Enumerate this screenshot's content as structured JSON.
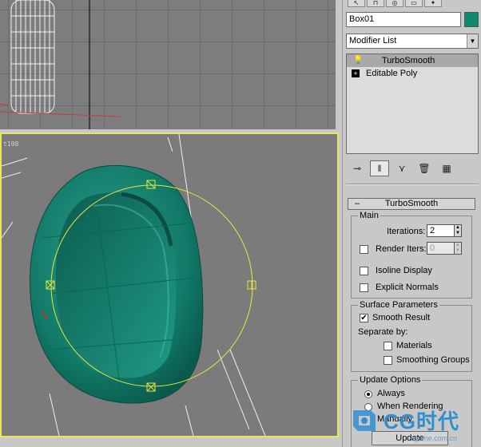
{
  "viewport": {
    "persp_label": "t198"
  },
  "panel": {
    "tab_icons": [
      "cursor-icon",
      "hierarchy-icon",
      "motion-icon",
      "display-icon",
      "utilities-icon"
    ],
    "object_name": "Box01",
    "object_color": "#0f8a72",
    "modifier_list_label": "Modifier List",
    "stack": [
      {
        "label": "TurboSmooth",
        "selected": true,
        "icon": "lightbulb-icon"
      },
      {
        "label": "Editable Poly",
        "selected": false,
        "icon": "expand-plus-icon"
      }
    ]
  },
  "turbosmooth": {
    "title": "TurboSmooth",
    "main": {
      "title": "Main",
      "iterations_label": "Iterations:",
      "iterations_value": "2",
      "render_iters_label": "Render Iters:",
      "render_iters_value": "0",
      "render_iters_checked": false,
      "isoline_label": "Isoline Display",
      "isoline_checked": false,
      "explicit_normals_label": "Explicit Normals",
      "explicit_normals_checked": false
    },
    "surface": {
      "title": "Surface Parameters",
      "smooth_result_label": "Smooth Result",
      "smooth_result_checked": true,
      "separate_by_label": "Separate by:",
      "materials_label": "Materials",
      "smoothing_groups_label": "Smoothing Groups"
    },
    "update": {
      "title": "Update Options",
      "always_label": "Always",
      "when_rendering_label": "When Rendering",
      "manually_label": "Manually",
      "selected": "always",
      "update_button_label": "Update"
    }
  },
  "watermark": {
    "text": "CG时代",
    "url": "cgtime.com.cn"
  }
}
